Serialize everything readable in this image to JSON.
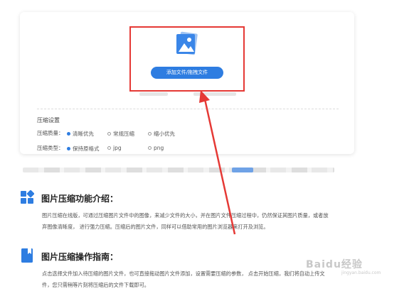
{
  "upload": {
    "button_label": "添加文件/拖拽文件"
  },
  "settings": {
    "title": "压缩设置",
    "quality": {
      "label": "压缩质量：",
      "options": [
        "清晰优先",
        "常规压缩",
        "缩小优先"
      ],
      "selected": "清晰优先"
    },
    "type": {
      "label": "压缩类型：",
      "options": [
        "保持原格式",
        "jpg",
        "png"
      ],
      "selected": "保持原格式"
    }
  },
  "intro": {
    "title": "图片压缩功能介绍：",
    "text_line1": "图片压缩在线版，可通过压缩图片文件中的图像，来减少文件的大小，并在图片文件压缩过程中，仍然保证其图片质量，或者放",
    "text_line2": "弃图像清晰度， 进行强力压缩。压缩后的图片文件，同样可以借助常用的图片浏览器来打开及浏览。"
  },
  "guide": {
    "title": "图片压缩操作指南：",
    "text_line1": "点击选择文件加入待压缩的图片文件，也可直接拖动图片文件添加，设置需要压缩的参数， 点击开始压缩，我们将自动上传文",
    "text_line2": "件，您只需稍等片刻将压缩后的文件下载即可。"
  },
  "watermark": {
    "brand": "Baidu经验",
    "sub": "jingyan.baidu.com"
  },
  "colors": {
    "accent": "#2e7de1",
    "highlight": "#e53935"
  }
}
